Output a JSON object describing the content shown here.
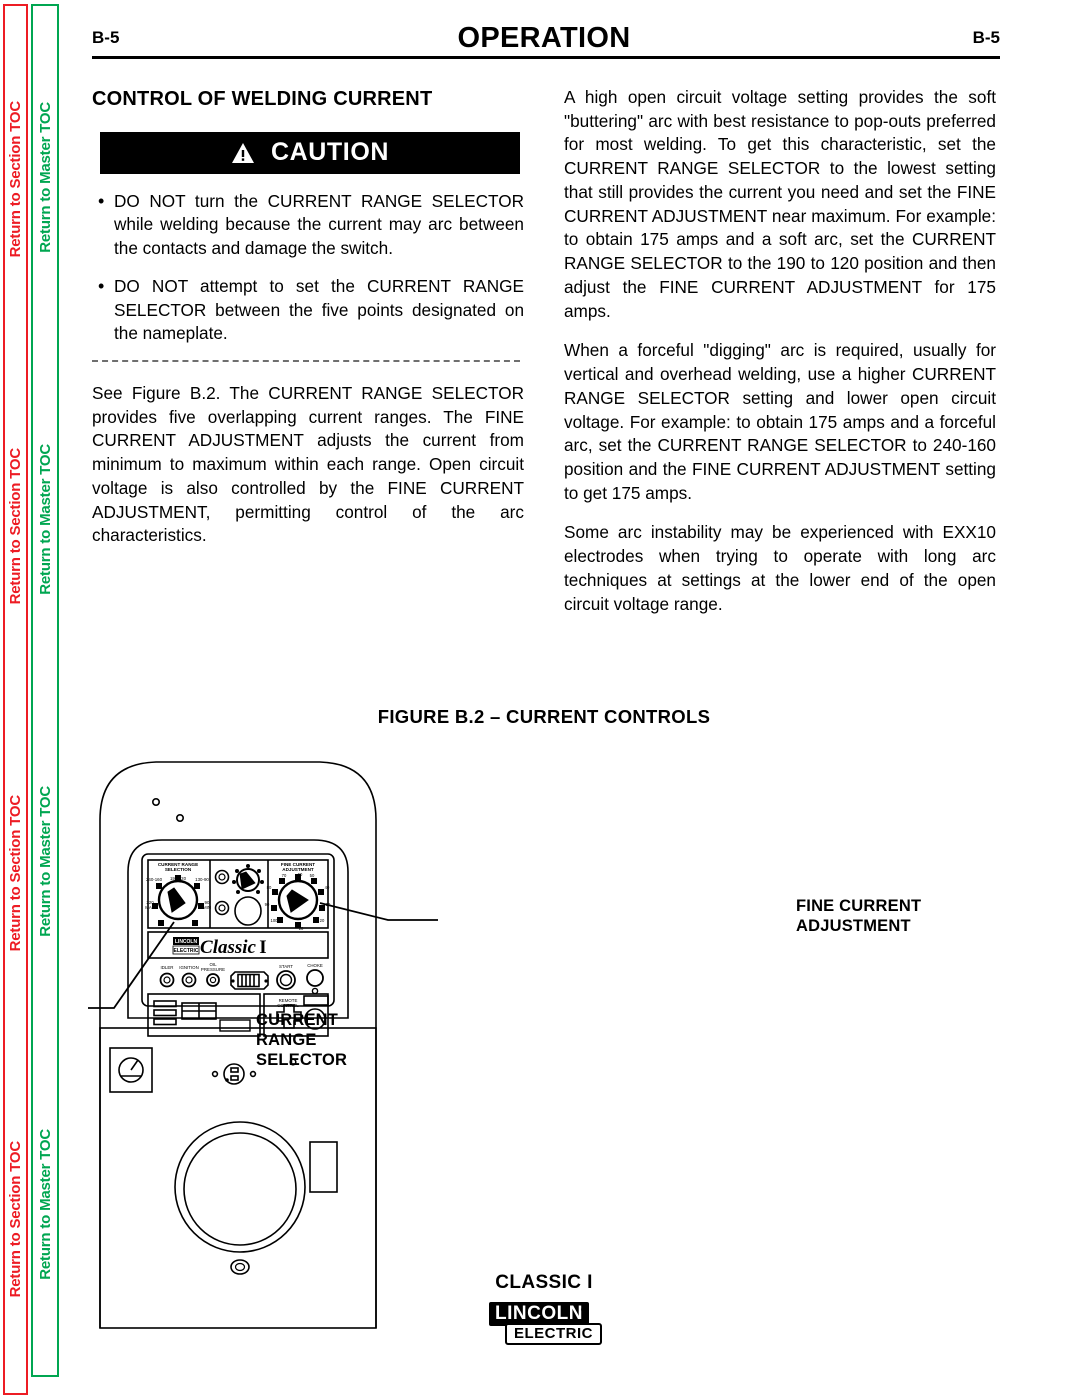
{
  "sidebar": {
    "section_toc": {
      "label": "Return to Section TOC",
      "color": "#ed1c24",
      "repeat": 4
    },
    "master_toc": {
      "label": "Return to Master TOC",
      "color": "#00a651",
      "repeat": 4
    }
  },
  "header": {
    "folio_left": "B-5",
    "folio_right": "B-5",
    "title": "OPERATION"
  },
  "left_column": {
    "subhead": "CONTROL OF WELDING CURRENT",
    "caution": {
      "label": "CAUTION",
      "icon": "warning-triangle-icon",
      "items": [
        "DO NOT turn the CURRENT RANGE SELECTOR while welding because the current may arc between the contacts and damage the switch.",
        "DO NOT attempt to set the CURRENT RANGE SELECTOR between the five points designated on the nameplate."
      ]
    },
    "paragraphs": [
      "See Figure B.2.  The CURRENT RANGE SELECTOR provides five overlapping current ranges.  The FINE CURRENT ADJUSTMENT adjusts the current from minimum to maximum within each range. Open circuit voltage is also controlled by the FINE CURRENT ADJUSTMENT, permitting control of the arc characteristics."
    ]
  },
  "right_column": {
    "paragraphs": [
      "A high open circuit voltage setting provides the soft \"buttering\" arc with best resistance to pop-outs preferred for most welding.  To get this characteristic, set the CURRENT RANGE SELECTOR to the lowest setting that still provides the current you need and set the FINE CURRENT ADJUSTMENT near maximum.  For example: to obtain 175 amps and a soft arc, set the CURRENT RANGE SELECTOR to the 190 to 120 position and then adjust the FINE CURRENT ADJUSTMENT for 175 amps.",
      "When a forceful \"digging\" arc is required, usually for vertical and overhead welding, use a higher CURRENT RANGE SELECTOR setting and lower open circuit voltage.  For example: to obtain 175 amps and a forceful arc, set the CURRENT RANGE SELECTOR to 240-160 position and the FINE CURRENT ADJUSTMENT setting to get 175 amps.",
      "Some arc instability may be experienced with EXX10 electrodes when trying to operate with long arc techniques at settings at the lower end of the open circuit voltage range."
    ]
  },
  "figure": {
    "title": "FIGURE B.2 – CURRENT CONTROLS",
    "caption": "CLASSIC I",
    "annotations": {
      "current_range_selector": "CURRENT RANGE SELECTOR",
      "fine_current_adjustment": "FINE CURRENT ADJUSTMENT"
    },
    "panel": {
      "brand_plate": "Classic",
      "brand_model": "I",
      "brand_logo_top": "LINCOLN",
      "brand_logo_bottom": "ELECTRIC",
      "current_range_selection": {
        "title_line1": "CURRENT RANGE",
        "title_line2": "SELECTION",
        "positions": [
          "240-160",
          "190-120",
          "130-90",
          "220 MAX",
          "90 MIN"
        ],
        "label_top": "190-120",
        "label_upper_left": "240-160",
        "label_upper_right": "130-90",
        "label_left_1": "220",
        "label_left_2": "MAX",
        "label_right_1": "90",
        "label_right_2": "MIN"
      },
      "fine_current_adjustment": {
        "title_line1": "FINE CURRENT",
        "title_line2": "ADJUSTMENT",
        "ticks": [
          "60",
          "50",
          "40",
          "30",
          "20",
          "10",
          "100",
          "90",
          "80",
          "70"
        ]
      },
      "controls_row": [
        "IDLER",
        "IGNITION",
        "OIL PRESSURE",
        "START",
        "CHOKE"
      ],
      "oil_pressure_line1": "OIL",
      "oil_pressure_line2": "PRESSURE",
      "remote_control_line1": "REMOTE",
      "remote_control_line2": "CONTROL"
    }
  },
  "logo": {
    "top": "LINCOLN",
    "registered": "®",
    "bottom": "ELECTRIC"
  }
}
